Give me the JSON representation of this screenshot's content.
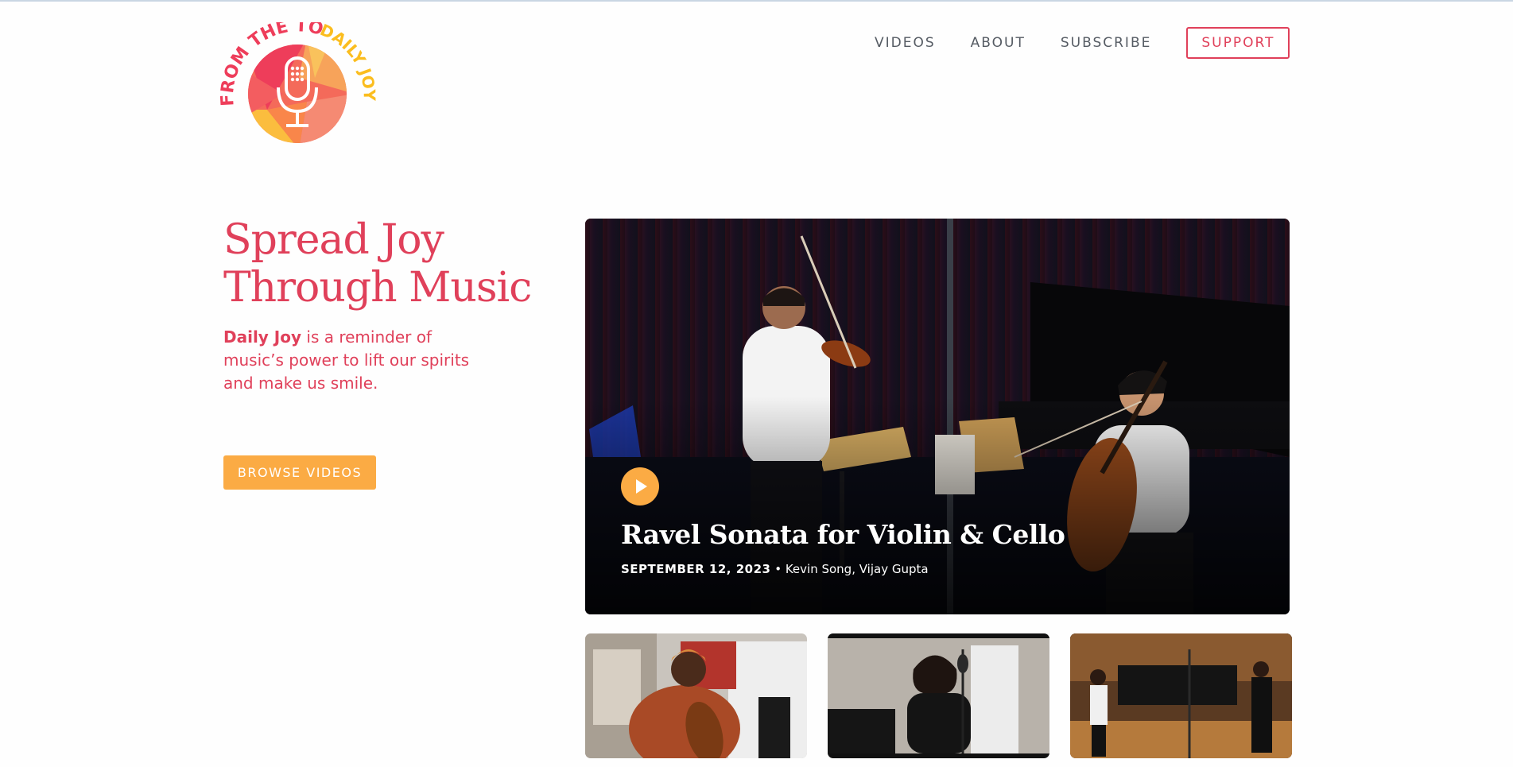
{
  "brand": {
    "arc_text_1": "FROM THE TOP",
    "arc_text_2": "DAILY JOY"
  },
  "nav": {
    "videos": "VIDEOS",
    "about": "ABOUT",
    "subscribe": "SUBSCRIBE",
    "support": "SUPPORT"
  },
  "hero": {
    "headline_line1": "Spread Joy",
    "headline_line2": "Through Music",
    "intro_bold": "Daily Joy",
    "intro_rest": " is a reminder of music’s power to lift our spirits and make us smile.",
    "browse_label": "BROWSE VIDEOS"
  },
  "featured": {
    "title": "Ravel Sonata for Violin & Cello",
    "date": "SEPTEMBER 12, 2023",
    "separator": " • ",
    "performers": "Kevin Song, Vijay Gupta"
  },
  "colors": {
    "accent": "#e0405a",
    "button": "#fbab44",
    "nav_text": "#555b63"
  }
}
